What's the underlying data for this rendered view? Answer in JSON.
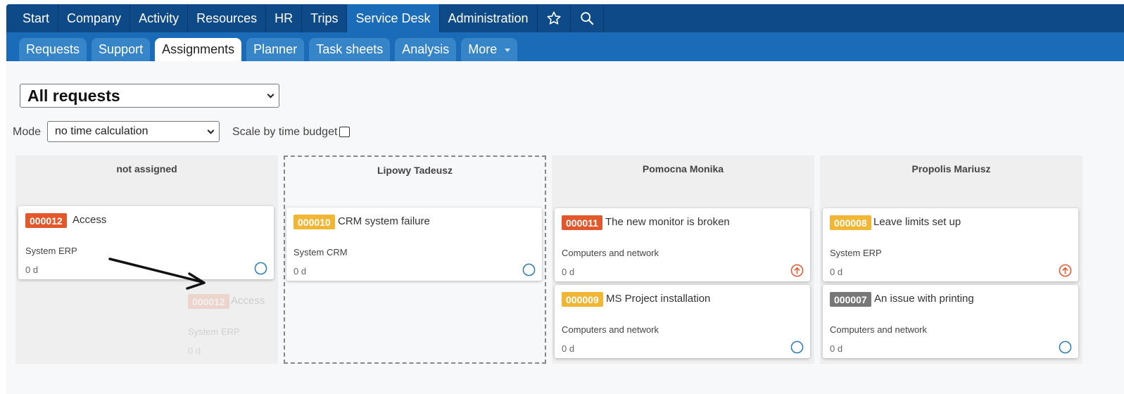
{
  "topnav": {
    "items": [
      "Start",
      "Company",
      "Activity",
      "Resources",
      "HR",
      "Trips",
      "Service Desk",
      "Administration"
    ],
    "active": "Service Desk",
    "icons": [
      "star-icon",
      "search-icon"
    ]
  },
  "subnav": {
    "tabs": [
      "Requests",
      "Support",
      "Assignments",
      "Planner",
      "Task sheets",
      "Analysis",
      "More"
    ],
    "active": "Assignments"
  },
  "filters": {
    "request_filter": "All requests",
    "mode_label": "Mode",
    "mode_value": "no time calculation",
    "scale_label": "Scale by time budget",
    "scale_checked": false
  },
  "columns": [
    {
      "name": "not assigned",
      "cards": [
        {
          "id": "000012",
          "title": "Access",
          "category": "System ERP",
          "duration": "0 d",
          "badge_color": "#e2582c",
          "status": "open"
        }
      ],
      "drag_ghost": {
        "id": "000012",
        "title": "Access",
        "category": "System ERP",
        "duration": "0 d"
      }
    },
    {
      "name": "Lipowy Tadeusz",
      "cards": [
        {
          "id": "000010",
          "title": "CRM system failure",
          "category": "System CRM",
          "duration": "0 d",
          "badge_color": "#f1b634",
          "status": "open"
        }
      ]
    },
    {
      "name": "Pomocna Monika",
      "cards": [
        {
          "id": "000011",
          "title": "The new monitor is broken",
          "category": "Computers and network",
          "duration": "0 d",
          "badge_color": "#e2582c",
          "status": "high-priority"
        },
        {
          "id": "000009",
          "title": "MS Project installation",
          "category": "Computers and network",
          "duration": "0 d",
          "badge_color": "#f1b634",
          "status": "open"
        }
      ]
    },
    {
      "name": "Propolis Mariusz",
      "cards": [
        {
          "id": "000008",
          "title": "Leave limits set up",
          "category": "System ERP",
          "duration": "0 d",
          "badge_color": "#f1b634",
          "status": "high-priority"
        },
        {
          "id": "000007",
          "title": "An issue with printing",
          "category": "Computers and network",
          "duration": "0 d",
          "badge_color": "#777777",
          "status": "open"
        }
      ]
    }
  ]
}
